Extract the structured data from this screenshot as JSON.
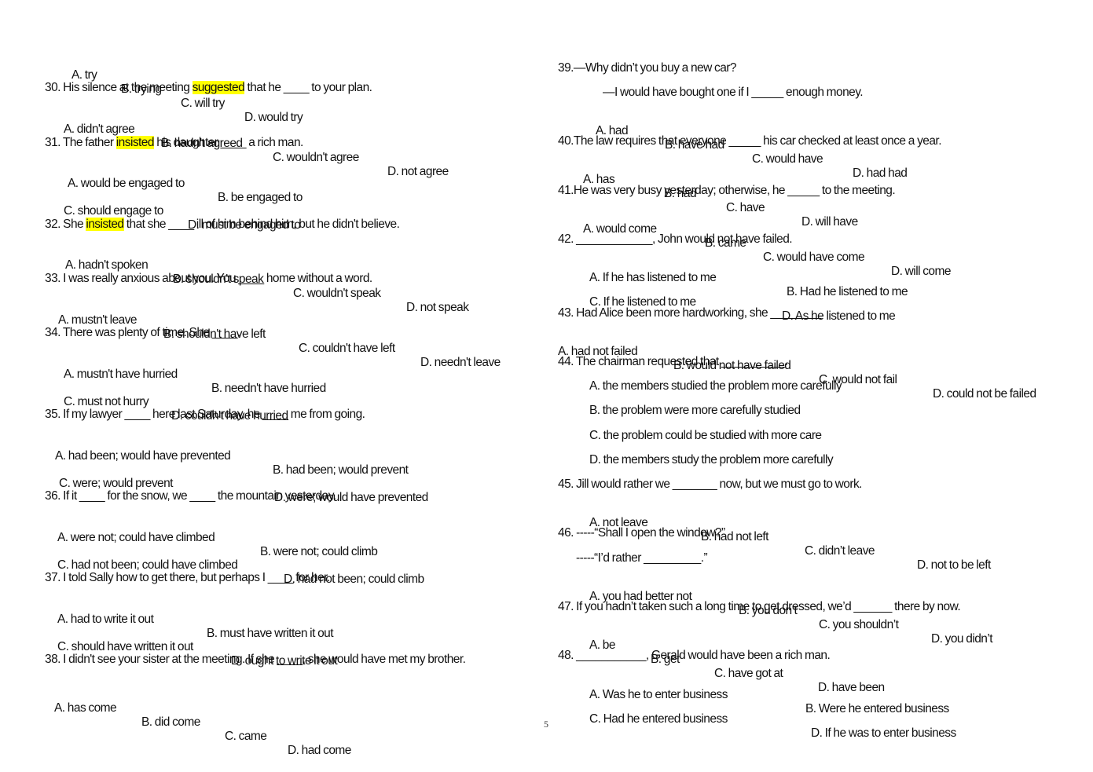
{
  "page_number": "5",
  "highlight_color": "#ffff00",
  "left_column": {
    "q29_options": [
      "A. try",
      "B. trying",
      "C. will try",
      "D. would try"
    ],
    "q30": {
      "pre": "30. His silence at the meeting ",
      "highlight": "suggested",
      "post": " that he ____ to your plan.",
      "options": [
        "A. didn't agree",
        "B. hadn't agreed",
        "C. wouldn't agree",
        "D. not agree"
      ]
    },
    "q31": {
      "pre": "31. The father ",
      "highlight": "insisted",
      "post": " his daughter ____ a rich man.",
      "options": [
        "A. would be engaged to",
        "B. be engaged to",
        "C. should engage to",
        "D. must be engaged to"
      ]
    },
    "q32": {
      "pre": "32. She ",
      "highlight": "insisted",
      "post": " that she ____ ill of him behind him, but he didn't believe.",
      "options": [
        "A. hadn't spoken",
        "B. shouldn't speak",
        "C. wouldn't speak",
        "D. not speak"
      ]
    },
    "q33": {
      "text": "33. I was really anxious about you. You ____ home without a word.",
      "options": [
        "A. mustn't leave",
        "B. shouldn't have left",
        "C. couldn't have left",
        "D. needn't leave"
      ]
    },
    "q34": {
      "text": "34. There was plenty of time. She ____.",
      "options": [
        "A. mustn't have hurried",
        "B. needn't have hurried",
        "C. must not hurry",
        "D. couldn't have hurried"
      ]
    },
    "q35": {
      "text": "35. If my lawyer ____ here last Saturday, he ____ me from going.",
      "options": [
        "A. had been; would have prevented",
        "B. had been; would prevent",
        "C. were; would prevent",
        "D. were; would have prevented"
      ]
    },
    "q36": {
      "text": "36. If it ____ for the snow, we ____ the mountain yesterday.",
      "options": [
        "A. were not; could have climbed",
        "B. were not; could climb",
        "C. had not been; could have climbed",
        "D. had not been; could climb"
      ]
    },
    "q37": {
      "text": "37. I told Sally how to get there, but perhaps I ____ for her.",
      "options": [
        "A. had to write it out",
        "B. must have written it out",
        "C. should have written it out",
        "D. ought to write it out"
      ]
    },
    "q38": {
      "text": "38. I didn't see your sister at the meeting. If she ____, she would have met my brother.",
      "options": [
        "A. has come",
        "B. did come",
        "C. came",
        "D. had come"
      ]
    }
  },
  "right_column": {
    "q39": {
      "text": "39.—Why didn’t you buy a new car?",
      "reply": "—I would have bought one if I _____ enough money.",
      "options": [
        "A. had",
        "B. have had",
        "C. would have",
        "D. had had"
      ]
    },
    "q40": {
      "text": "40.The law requires that everyone _____ his car checked at least once a year.",
      "options": [
        "A. has",
        "B. had",
        "C. have",
        "D. will have"
      ]
    },
    "q41": {
      "text": "41.He was very busy yesterday; otherwise, he _____ to the meeting.",
      "options": [
        "A. would come",
        "B. came",
        "C. would have come",
        "D. will come"
      ]
    },
    "q42": {
      "text": "42. ____________, John would not have failed.",
      "options": [
        "A. If he has listened to me",
        "B. Had he listened to me",
        "C. If he listened to me",
        "D. As he listened to me"
      ]
    },
    "q43": {
      "text": "43. Had Alice been more hardworking, she ________.",
      "options": [
        "A. had not failed",
        "B. would not have failed",
        "C. would not fail",
        "D. could not be failed"
      ]
    },
    "q44": {
      "text": "44. The chairman requested that __________.",
      "options": [
        "A. the members studied the problem more carefully",
        "B. the problem were more carefully studied",
        "C. the problem could be studied with more care",
        "D. the members study the problem more carefully"
      ]
    },
    "q45": {
      "text": "45. Jill would rather we _______ now, but we must go to work.",
      "options": [
        "A. not leave",
        "B. had not left",
        "C. didn’t leave",
        "D. not to be left"
      ]
    },
    "q46": {
      "text": "46. -----“Shall I open the window?”",
      "reply": "-----“I’d rather _________.”",
      "options": [
        "A. you had better not",
        "B. you don’t",
        "C. you shouldn’t",
        "D. you didn’t"
      ]
    },
    "q47": {
      "text": "47. If you hadn’t taken such a long time to get dressed, we’d ______ there by now.",
      "options": [
        "A. be",
        "B. get",
        "C. have got at",
        "D. have been"
      ]
    },
    "q48": {
      "text": "48. ___________, Gerald would have been a rich man.",
      "options": [
        "A. Was he to enter business",
        "B. Were he entered business",
        "C. Had he entered business",
        "D. If he was to enter business"
      ]
    }
  }
}
